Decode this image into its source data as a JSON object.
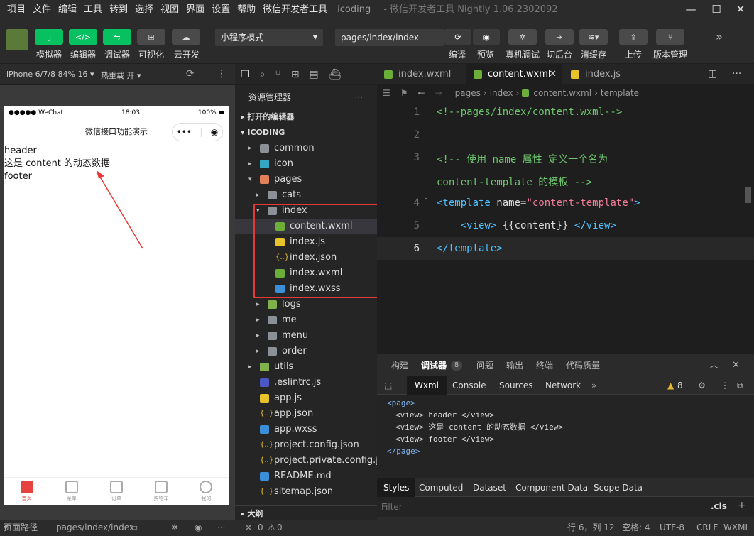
{
  "menubar": {
    "items": [
      "项目",
      "文件",
      "编辑",
      "工具",
      "转到",
      "选择",
      "视图",
      "界面",
      "设置",
      "帮助",
      "微信开发者工具"
    ],
    "app": "icoding",
    "title": "- 微信开发者工具 Nightly 1.06.2302092"
  },
  "toolbar": {
    "simulator": "模拟器",
    "editor": "编辑器",
    "debugger": "调试器",
    "visual": "可视化",
    "cloud": "云开发",
    "mode": "小程序模式",
    "page_path": "pages/index/index",
    "compile": "编译",
    "preview": "预览",
    "remote_debug": "真机调试",
    "background": "切后台",
    "clear_cache": "清缓存",
    "upload": "上传",
    "version": "版本管理"
  },
  "simulator": {
    "device": "iPhone 6/7/8 84% 16",
    "hotreload": "热重载 开",
    "status_left": "●●●●● WeChat",
    "status_time": "18:03",
    "status_right": "100%",
    "nav_title": "微信接口功能演示",
    "lines": [
      "header",
      "这是 content 的动态数据",
      "footer"
    ],
    "tabs": [
      "首页",
      "菜单",
      "订单",
      "购物车",
      "我的"
    ]
  },
  "explorer": {
    "title": "资源管理器",
    "open_editors": "打开的编辑器",
    "project": "ICODING",
    "outline": "大纲",
    "tree": [
      {
        "name": "common",
        "level": 1,
        "type": "folder",
        "twisty": "▸"
      },
      {
        "name": "icon",
        "level": 1,
        "type": "folder-c",
        "twisty": "▸"
      },
      {
        "name": "pages",
        "level": 1,
        "type": "folder-r",
        "twisty": "▾"
      },
      {
        "name": "cats",
        "level": 2,
        "type": "folder",
        "twisty": "▸"
      },
      {
        "name": "index",
        "level": 2,
        "type": "folder",
        "twisty": "▾"
      },
      {
        "name": "content.wxml",
        "level": 3,
        "type": "fwxml",
        "selected": true
      },
      {
        "name": "index.js",
        "level": 3,
        "type": "fjs"
      },
      {
        "name": "index.json",
        "level": 3,
        "type": "fjson"
      },
      {
        "name": "index.wxml",
        "level": 3,
        "type": "fwxml"
      },
      {
        "name": "index.wxss",
        "level": 3,
        "type": "fwxss"
      },
      {
        "name": "logs",
        "level": 2,
        "type": "folder-g",
        "twisty": "▸"
      },
      {
        "name": "me",
        "level": 2,
        "type": "folder",
        "twisty": "▸"
      },
      {
        "name": "menu",
        "level": 2,
        "type": "folder",
        "twisty": "▸"
      },
      {
        "name": "order",
        "level": 2,
        "type": "folder",
        "twisty": "▸"
      },
      {
        "name": "utils",
        "level": 1,
        "type": "folder-g",
        "twisty": "▸"
      },
      {
        "name": ".eslintrc.js",
        "level": 1,
        "type": "feslint"
      },
      {
        "name": "app.js",
        "level": 1,
        "type": "fjs"
      },
      {
        "name": "app.json",
        "level": 1,
        "type": "fjson"
      },
      {
        "name": "app.wxss",
        "level": 1,
        "type": "fwxss"
      },
      {
        "name": "project.config.json",
        "level": 1,
        "type": "fjson"
      },
      {
        "name": "project.private.config.js...",
        "level": 1,
        "type": "fjson"
      },
      {
        "name": "README.md",
        "level": 1,
        "type": "finfo"
      },
      {
        "name": "sitemap.json",
        "level": 1,
        "type": "fjson"
      }
    ]
  },
  "editor": {
    "tabs": [
      {
        "label": "index.wxml",
        "icon": "wxml"
      },
      {
        "label": "content.wxml",
        "icon": "wxml",
        "active": true
      },
      {
        "label": "index.js",
        "icon": "js"
      }
    ],
    "breadcrumb": [
      "pages",
      "index",
      "content.wxml",
      "template"
    ],
    "line_numbers": [
      "1",
      "2",
      "3",
      "",
      "4",
      "5",
      "6"
    ]
  },
  "debugger": {
    "tabs": [
      "构建",
      "调试器",
      "8",
      "问题",
      "输出",
      "终端",
      "代码质量"
    ],
    "devtools_tabs": [
      "Wxml",
      "Console",
      "Sources",
      "Network"
    ],
    "warn_count": "8",
    "wxml_lines": [
      "<page>",
      "<view> header </view>",
      "<view> 这是 content 的动态数据 </view>",
      "<view> footer </view>",
      "</page>"
    ],
    "style_tabs": [
      "Styles",
      "Computed",
      "Dataset",
      "Component Data",
      "Scope Data"
    ],
    "filter_placeholder": "Filter",
    "cls": ".cls"
  },
  "statusbar": {
    "page_route_label": "页面路径",
    "page_route": "pages/index/index",
    "errors": "0",
    "warnings": "0",
    "position": "行 6，列 12",
    "spaces": "空格: 4",
    "encoding": "UTF-8",
    "eol": "CRLF",
    "language": "WXML"
  }
}
